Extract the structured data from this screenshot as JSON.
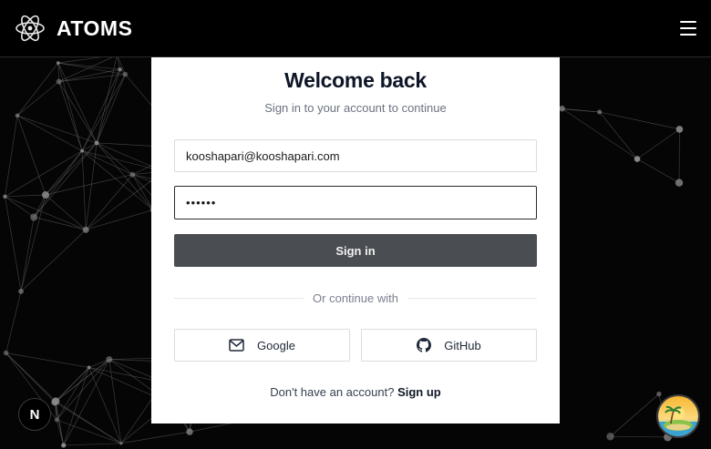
{
  "header": {
    "brand": "ATOMS",
    "logo_icon": "atom-icon",
    "menu_icon": "hamburger-menu-icon"
  },
  "login": {
    "title": "Welcome back",
    "subtitle": "Sign in to your account to continue",
    "email_value": "kooshapari@kooshapari.com",
    "password_value": "••••••",
    "signin_label": "Sign in",
    "divider_text": "Or continue with",
    "google_label": "Google",
    "google_icon": "mail-icon",
    "github_label": "GitHub",
    "github_icon": "github-icon",
    "signup_prompt": "Don't have an account?",
    "signup_link": "Sign up"
  },
  "overlay": {
    "next_badge": "N",
    "avatar_icon": "island-avatar-icon"
  },
  "colors": {
    "background": "#050505",
    "card": "#ffffff",
    "signin_button": "#4a4d52",
    "title_text": "#0d1526"
  }
}
